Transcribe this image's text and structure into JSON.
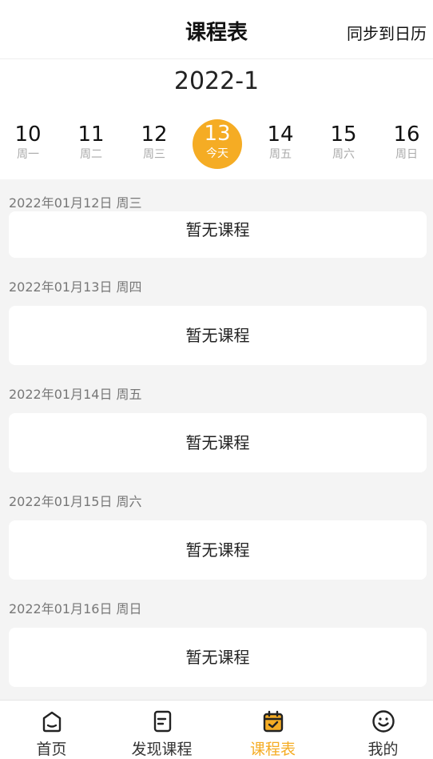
{
  "header": {
    "title": "课程表",
    "sync_label": "同步到日历"
  },
  "week": {
    "month": "2022-1",
    "days": [
      {
        "num": "10",
        "label": "周一"
      },
      {
        "num": "11",
        "label": "周二"
      },
      {
        "num": "12",
        "label": "周三"
      },
      {
        "num": "13",
        "label": "今天"
      },
      {
        "num": "14",
        "label": "周五"
      },
      {
        "num": "15",
        "label": "周六"
      },
      {
        "num": "16",
        "label": "周日"
      }
    ]
  },
  "schedule": [
    {
      "date": "2022年01月12日 周三",
      "content": "暂无课程"
    },
    {
      "date": "2022年01月13日 周四",
      "content": "暂无课程"
    },
    {
      "date": "2022年01月14日 周五",
      "content": "暂无课程"
    },
    {
      "date": "2022年01月15日 周六",
      "content": "暂无课程"
    },
    {
      "date": "2022年01月16日 周日",
      "content": "暂无课程"
    }
  ],
  "tabbar": {
    "items": [
      {
        "label": "首页",
        "icon": "home-icon"
      },
      {
        "label": "发现课程",
        "icon": "course-book-icon"
      },
      {
        "label": "课程表",
        "icon": "calendar-check-icon"
      },
      {
        "label": "我的",
        "icon": "smiley-icon"
      }
    ]
  },
  "colors": {
    "accent": "#f5ac24",
    "background": "#f4f4f4"
  }
}
